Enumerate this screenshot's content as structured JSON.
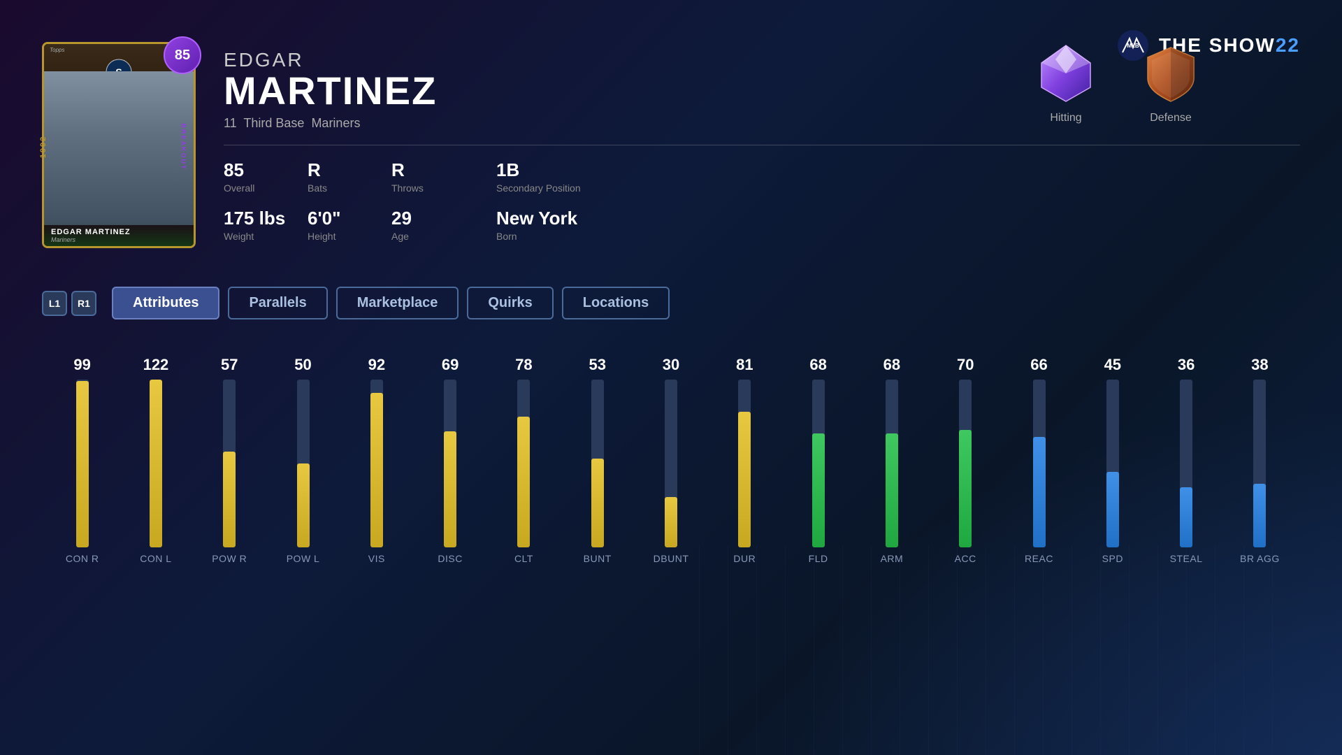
{
  "logo": {
    "text": "THE SHOW",
    "year": "22"
  },
  "player": {
    "first_name": "EDGAR",
    "last_name": "MARTINEZ",
    "number": "11",
    "position": "Third Base",
    "team": "Mariners",
    "overall": "85",
    "bats": "R",
    "throws": "R",
    "secondary_position": "1B",
    "weight": "175 lbs",
    "height": "6'0\"",
    "age": "29",
    "born": "New York",
    "card_year": "1992",
    "card_type": "BREAKOUT",
    "card_name": "EDGAR MARTINEZ",
    "card_team": "Mariners"
  },
  "labels": {
    "overall": "Overall",
    "bats": "Bats",
    "throws": "Throws",
    "secondary_position": "Secondary Position",
    "weight": "Weight",
    "height": "Height",
    "age": "Age",
    "born": "Born",
    "hitting": "Hitting",
    "defense": "Defense",
    "l1": "L1",
    "r1": "R1"
  },
  "tabs": [
    {
      "id": "attributes",
      "label": "Attributes",
      "active": true
    },
    {
      "id": "parallels",
      "label": "Parallels",
      "active": false
    },
    {
      "id": "marketplace",
      "label": "Marketplace",
      "active": false
    },
    {
      "id": "quirks",
      "label": "Quirks",
      "active": false
    },
    {
      "id": "locations",
      "label": "Locations",
      "active": false
    }
  ],
  "attributes": [
    {
      "abbr": "CON R",
      "value": 99,
      "color": "yellow",
      "pct": 99
    },
    {
      "abbr": "CON L",
      "value": 122,
      "color": "yellow",
      "pct": 100
    },
    {
      "abbr": "POW R",
      "value": 57,
      "color": "yellow",
      "pct": 57
    },
    {
      "abbr": "POW L",
      "value": 50,
      "color": "yellow",
      "pct": 50
    },
    {
      "abbr": "VIS",
      "value": 92,
      "color": "yellow",
      "pct": 92
    },
    {
      "abbr": "DISC",
      "value": 69,
      "color": "yellow",
      "pct": 69
    },
    {
      "abbr": "CLT",
      "value": 78,
      "color": "yellow",
      "pct": 78
    },
    {
      "abbr": "BUNT",
      "value": 53,
      "color": "yellow",
      "pct": 53
    },
    {
      "abbr": "DBUNT",
      "value": 30,
      "color": "yellow",
      "pct": 30
    },
    {
      "abbr": "DUR",
      "value": 81,
      "color": "yellow",
      "pct": 81
    },
    {
      "abbr": "FLD",
      "value": 68,
      "color": "green",
      "pct": 68
    },
    {
      "abbr": "ARM",
      "value": 68,
      "color": "green",
      "pct": 68
    },
    {
      "abbr": "ACC",
      "value": 70,
      "color": "green",
      "pct": 70
    },
    {
      "abbr": "REAC",
      "value": 66,
      "color": "blue",
      "pct": 66
    },
    {
      "abbr": "SPD",
      "value": 45,
      "color": "blue",
      "pct": 45
    },
    {
      "abbr": "STEAL",
      "value": 36,
      "color": "blue",
      "pct": 36
    },
    {
      "abbr": "BR AGG",
      "value": 38,
      "color": "blue",
      "pct": 38
    }
  ]
}
